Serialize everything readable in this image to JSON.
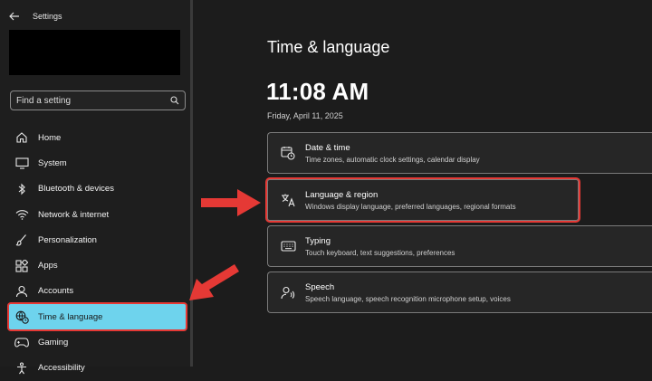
{
  "window": {
    "title": "Settings"
  },
  "search": {
    "placeholder": "Find a setting"
  },
  "sidebar": {
    "items": [
      {
        "label": "Home",
        "icon": "home-icon"
      },
      {
        "label": "System",
        "icon": "monitor-icon"
      },
      {
        "label": "Bluetooth & devices",
        "icon": "bluetooth-icon"
      },
      {
        "label": "Network & internet",
        "icon": "wifi-icon"
      },
      {
        "label": "Personalization",
        "icon": "brush-icon"
      },
      {
        "label": "Apps",
        "icon": "apps-icon"
      },
      {
        "label": "Accounts",
        "icon": "person-icon"
      },
      {
        "label": "Time & language",
        "icon": "globe-clock-icon",
        "active": true
      },
      {
        "label": "Gaming",
        "icon": "gamepad-icon"
      },
      {
        "label": "Accessibility",
        "icon": "accessibility-icon"
      }
    ]
  },
  "main": {
    "title": "Time & language",
    "time": "11:08 AM",
    "date": "Friday, April 11, 2025",
    "cards": [
      {
        "title": "Date & time",
        "subtitle": "Time zones, automatic clock settings, calendar display",
        "icon": "calendar-clock-icon"
      },
      {
        "title": "Language & region",
        "subtitle": "Windows display language, preferred languages, regional formats",
        "icon": "language-icon"
      },
      {
        "title": "Typing",
        "subtitle": "Touch keyboard, text suggestions, preferences",
        "icon": "keyboard-icon"
      },
      {
        "title": "Speech",
        "subtitle": "Speech language, speech recognition microphone setup, voices",
        "icon": "speech-icon"
      }
    ]
  },
  "colors": {
    "accent": "#6ed3ed",
    "highlight": "#e53935",
    "background": "#1c1c1c"
  }
}
